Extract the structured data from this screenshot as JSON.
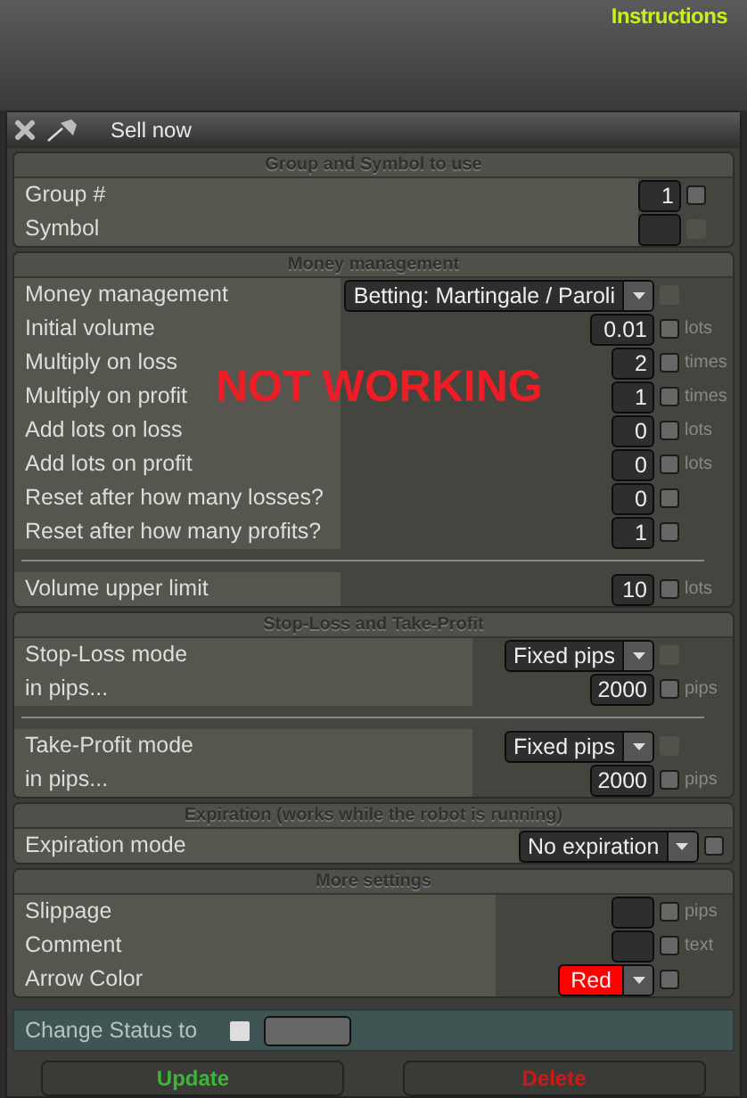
{
  "top_bar": {
    "link": "Instructions"
  },
  "dialog": {
    "title": "Sell now"
  },
  "overlay_text": "NOT WORKING",
  "sections": [
    {
      "title": "Group and Symbol to use",
      "rows": [
        {
          "label": "Group #",
          "kind": "input",
          "value": "1",
          "checked": false,
          "disabled": false
        },
        {
          "label": "Symbol",
          "kind": "input",
          "value": "",
          "checked": false,
          "disabled": true
        }
      ]
    },
    {
      "title": "Money management",
      "rows": [
        {
          "label": "Money management",
          "kind": "select",
          "value": "Betting: Martingale / Paroli",
          "checked": false,
          "disabled": true
        },
        {
          "label": "Initial volume",
          "kind": "input",
          "value": "0.01",
          "unit": "lots",
          "checked": false,
          "disabled": false
        },
        {
          "label": "Multiply on loss",
          "kind": "input",
          "value": "2",
          "unit": "times",
          "checked": false,
          "disabled": false
        },
        {
          "label": "Multiply on profit",
          "kind": "input",
          "value": "1",
          "unit": "times",
          "checked": false,
          "disabled": false
        },
        {
          "label": "Add lots on loss",
          "kind": "input",
          "value": "0",
          "unit": "lots",
          "checked": false,
          "disabled": false
        },
        {
          "label": "Add lots on profit",
          "kind": "input",
          "value": "0",
          "unit": "lots",
          "checked": false,
          "disabled": false
        },
        {
          "label": "Reset after how many losses?",
          "kind": "input",
          "value": "0",
          "checked": false,
          "disabled": false
        },
        {
          "label": "Reset after how many profits?",
          "kind": "input",
          "value": "1",
          "checked": false,
          "disabled": false
        },
        {
          "label": "Volume upper limit",
          "kind": "input",
          "value": "10",
          "unit": "lots",
          "checked": false,
          "disabled": false,
          "divider_before": true
        }
      ]
    },
    {
      "title": "Stop-Loss and Take-Profit",
      "rows": [
        {
          "label": "Stop-Loss mode",
          "kind": "select",
          "value": "Fixed pips",
          "checked": false,
          "disabled": true
        },
        {
          "label": "in pips...",
          "kind": "input",
          "value": "2000",
          "unit": "pips",
          "checked": false,
          "disabled": false
        },
        {
          "label": "Take-Profit mode",
          "kind": "select",
          "value": "Fixed pips",
          "checked": false,
          "disabled": true,
          "divider_before": true
        },
        {
          "label": "in pips...",
          "kind": "input",
          "value": "2000",
          "unit": "pips",
          "checked": false,
          "disabled": false
        }
      ]
    },
    {
      "title": "Expiration (works while the robot is running)",
      "rows": [
        {
          "label": "Expiration mode",
          "kind": "select",
          "value": "No expiration",
          "checked": false,
          "disabled": false
        }
      ]
    },
    {
      "title": "More settings",
      "rows": [
        {
          "label": "Slippage",
          "kind": "input",
          "value": "",
          "unit": "pips",
          "checked": false,
          "disabled": false
        },
        {
          "label": "Comment",
          "kind": "input",
          "value": "",
          "unit": "text",
          "checked": false,
          "disabled": false
        },
        {
          "label": "Arrow Color",
          "kind": "color",
          "value": "Red",
          "color": "#ff0000",
          "checked": false,
          "disabled": false
        }
      ]
    }
  ],
  "status": {
    "label": "Change Status to",
    "checked": false
  },
  "buttons": [
    {
      "label": "Update",
      "kind": "ok"
    },
    {
      "label": "Delete",
      "kind": "danger"
    }
  ]
}
